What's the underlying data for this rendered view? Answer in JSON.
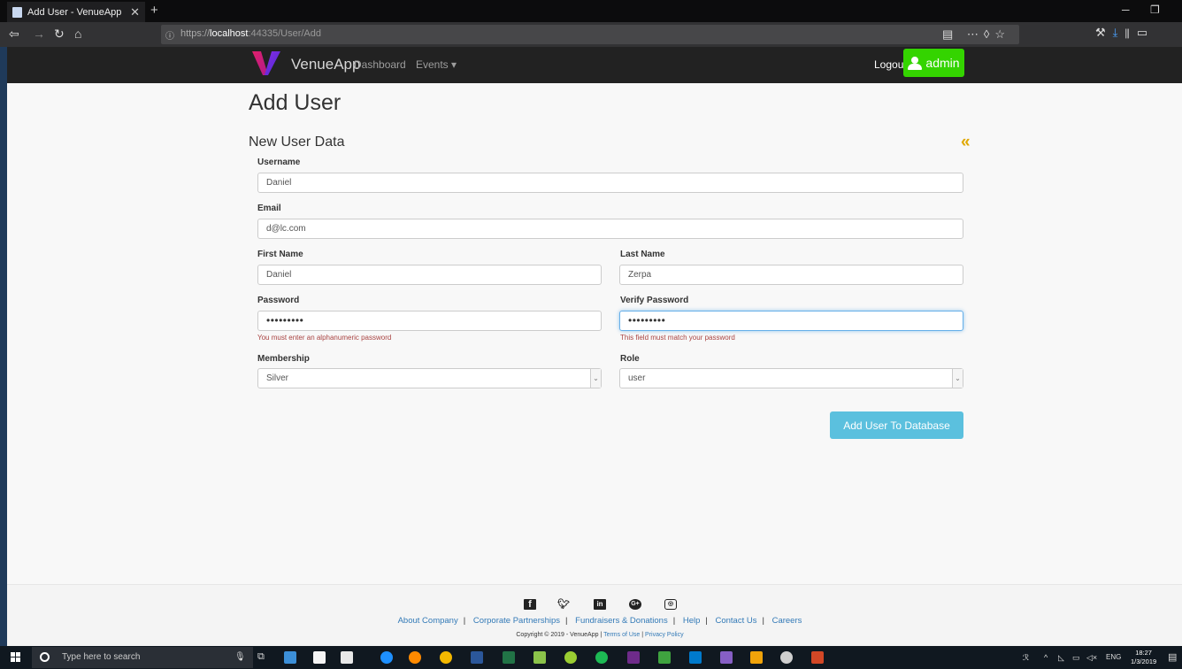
{
  "browser": {
    "tab_title": "Add User - VenueApp",
    "url_prefix": "https://",
    "url_host": "localhost",
    "url_path": ":44335/User/Add"
  },
  "appbar": {
    "brand": "VenueApp",
    "nav": [
      "Dashboard",
      "Events ▾"
    ],
    "logout": "Logout",
    "admin_label": "admin",
    "accent_color": "#34d400"
  },
  "page": {
    "title": "Add User",
    "subtitle": "New User Data",
    "back_icon": "«"
  },
  "form": {
    "username": {
      "label": "Username",
      "value": "Daniel"
    },
    "email": {
      "label": "Email",
      "value": "d@lc.com"
    },
    "first_name": {
      "label": "First Name",
      "value": "Daniel"
    },
    "last_name": {
      "label": "Last Name",
      "value": "Zerpa"
    },
    "password": {
      "label": "Password",
      "value": "•••••••••",
      "error": "You must enter an alphanumeric password"
    },
    "verify_password": {
      "label": "Verify Password",
      "value": "•••••••••",
      "error": "This field must match your password"
    },
    "membership": {
      "label": "Membership",
      "value": "Silver"
    },
    "role": {
      "label": "Role",
      "value": "user"
    },
    "submit": "Add User To Database"
  },
  "footer": {
    "social_icons": [
      "facebook-icon",
      "twitter-icon",
      "linkedin-icon",
      "google-plus-icon",
      "instagram-icon"
    ],
    "links": [
      "About Company",
      "Corporate Partnerships",
      "Fundraisers & Donations",
      "Help",
      "Contact Us",
      "Careers"
    ],
    "copyright": "Copyright © 2019 - VenueApp | ",
    "terms": "Terms of Use",
    "privacy": "Privacy Policy"
  },
  "taskbar": {
    "search_placeholder": "Type here to search",
    "lang": "ENG",
    "time": "18:27",
    "date": "1/3/2019"
  }
}
